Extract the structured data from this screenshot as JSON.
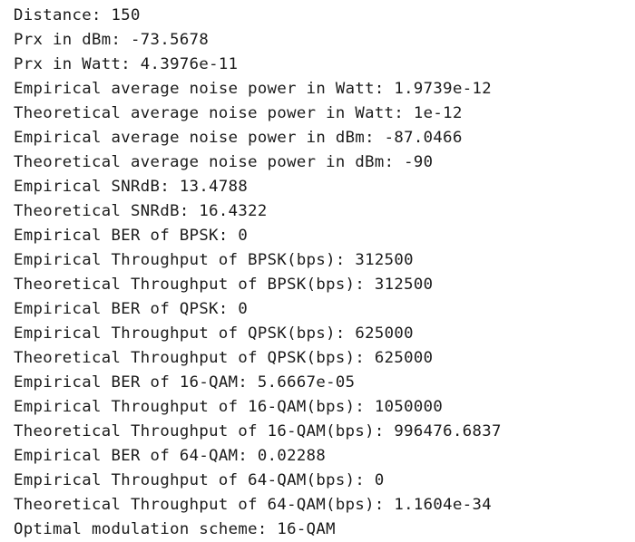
{
  "console": {
    "lines": [
      "Distance: 150",
      "Prx in dBm: -73.5678",
      "Prx in Watt: 4.3976e-11",
      "Empirical average noise power in Watt: 1.9739e-12",
      "Theoretical average noise power in Watt: 1e-12",
      "Empirical average noise power in dBm: -87.0466",
      "Theoretical average noise power in dBm: -90",
      "Empirical SNRdB: 13.4788",
      "Theoretical SNRdB: 16.4322",
      "Empirical BER of BPSK: 0",
      "Empirical Throughput of BPSK(bps): 312500",
      "Theoretical Throughput of BPSK(bps): 312500",
      "Empirical BER of QPSK: 0",
      "Empirical Throughput of QPSK(bps): 625000",
      "Theoretical Throughput of QPSK(bps): 625000",
      "Empirical BER of 16-QAM: 5.6667e-05",
      "Empirical Throughput of 16-QAM(bps): 1050000",
      "Theoretical Throughput of 16-QAM(bps): 996476.6837",
      "Empirical BER of 64-QAM: 0.02288",
      "Empirical Throughput of 64-QAM(bps): 0",
      "Theoretical Throughput of 64-QAM(bps): 1.1604e-34",
      "Optimal modulation scheme: 16-QAM"
    ]
  }
}
